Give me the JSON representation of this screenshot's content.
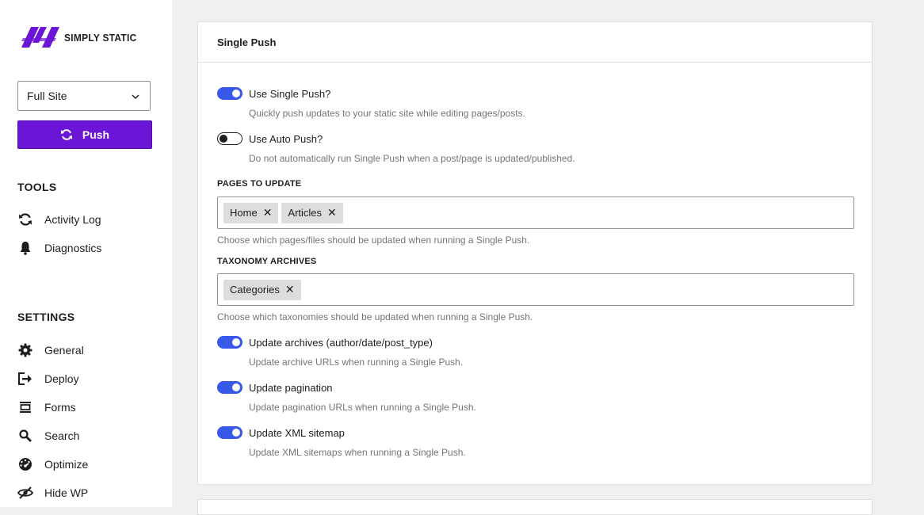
{
  "sidebar": {
    "logo_text": "SIMPLY STATIC",
    "select_value": "Full Site",
    "push_label": "Push",
    "tools_title": "TOOLS",
    "tools": [
      {
        "label": "Activity Log",
        "icon": "refresh-icon"
      },
      {
        "label": "Diagnostics",
        "icon": "bell-icon"
      }
    ],
    "settings_title": "SETTINGS",
    "settings": [
      {
        "label": "General",
        "icon": "gear-icon"
      },
      {
        "label": "Deploy",
        "icon": "deploy-icon"
      },
      {
        "label": "Forms",
        "icon": "forms-icon"
      },
      {
        "label": "Search",
        "icon": "search-icon"
      },
      {
        "label": "Optimize",
        "icon": "gauge-icon"
      },
      {
        "label": "Hide WP",
        "icon": "eye-slash-icon"
      }
    ]
  },
  "panel": {
    "title": "Single Push",
    "use_single_push": {
      "label": "Use Single Push?",
      "help": "Quickly push updates to your static site while editing pages/posts.",
      "on": true
    },
    "use_auto_push": {
      "label": "Use Auto Push?",
      "help": "Do not automatically run Single Push when a post/page is updated/published.",
      "on": false
    },
    "pages_label": "PAGES TO UPDATE",
    "pages_tokens": [
      "Home",
      "Articles"
    ],
    "pages_help": "Choose which pages/files should be updated when running a Single Push.",
    "taxonomy_label": "TAXONOMY ARCHIVES",
    "taxonomy_tokens": [
      "Categories"
    ],
    "taxonomy_help": "Choose which taxonomies should be updated when running a Single Push.",
    "update_archives": {
      "label": "Update archives (author/date/post_type)",
      "help": "Update archive URLs when running a Single Push.",
      "on": true
    },
    "update_pagination": {
      "label": "Update pagination",
      "help": "Update pagination URLs when running a Single Push.",
      "on": true
    },
    "update_sitemap": {
      "label": "Update XML sitemap",
      "help": "Update XML sitemaps when running a Single Push.",
      "on": true
    }
  },
  "colors": {
    "accent": "#6b16d6",
    "toggle_on": "#3858e9"
  }
}
